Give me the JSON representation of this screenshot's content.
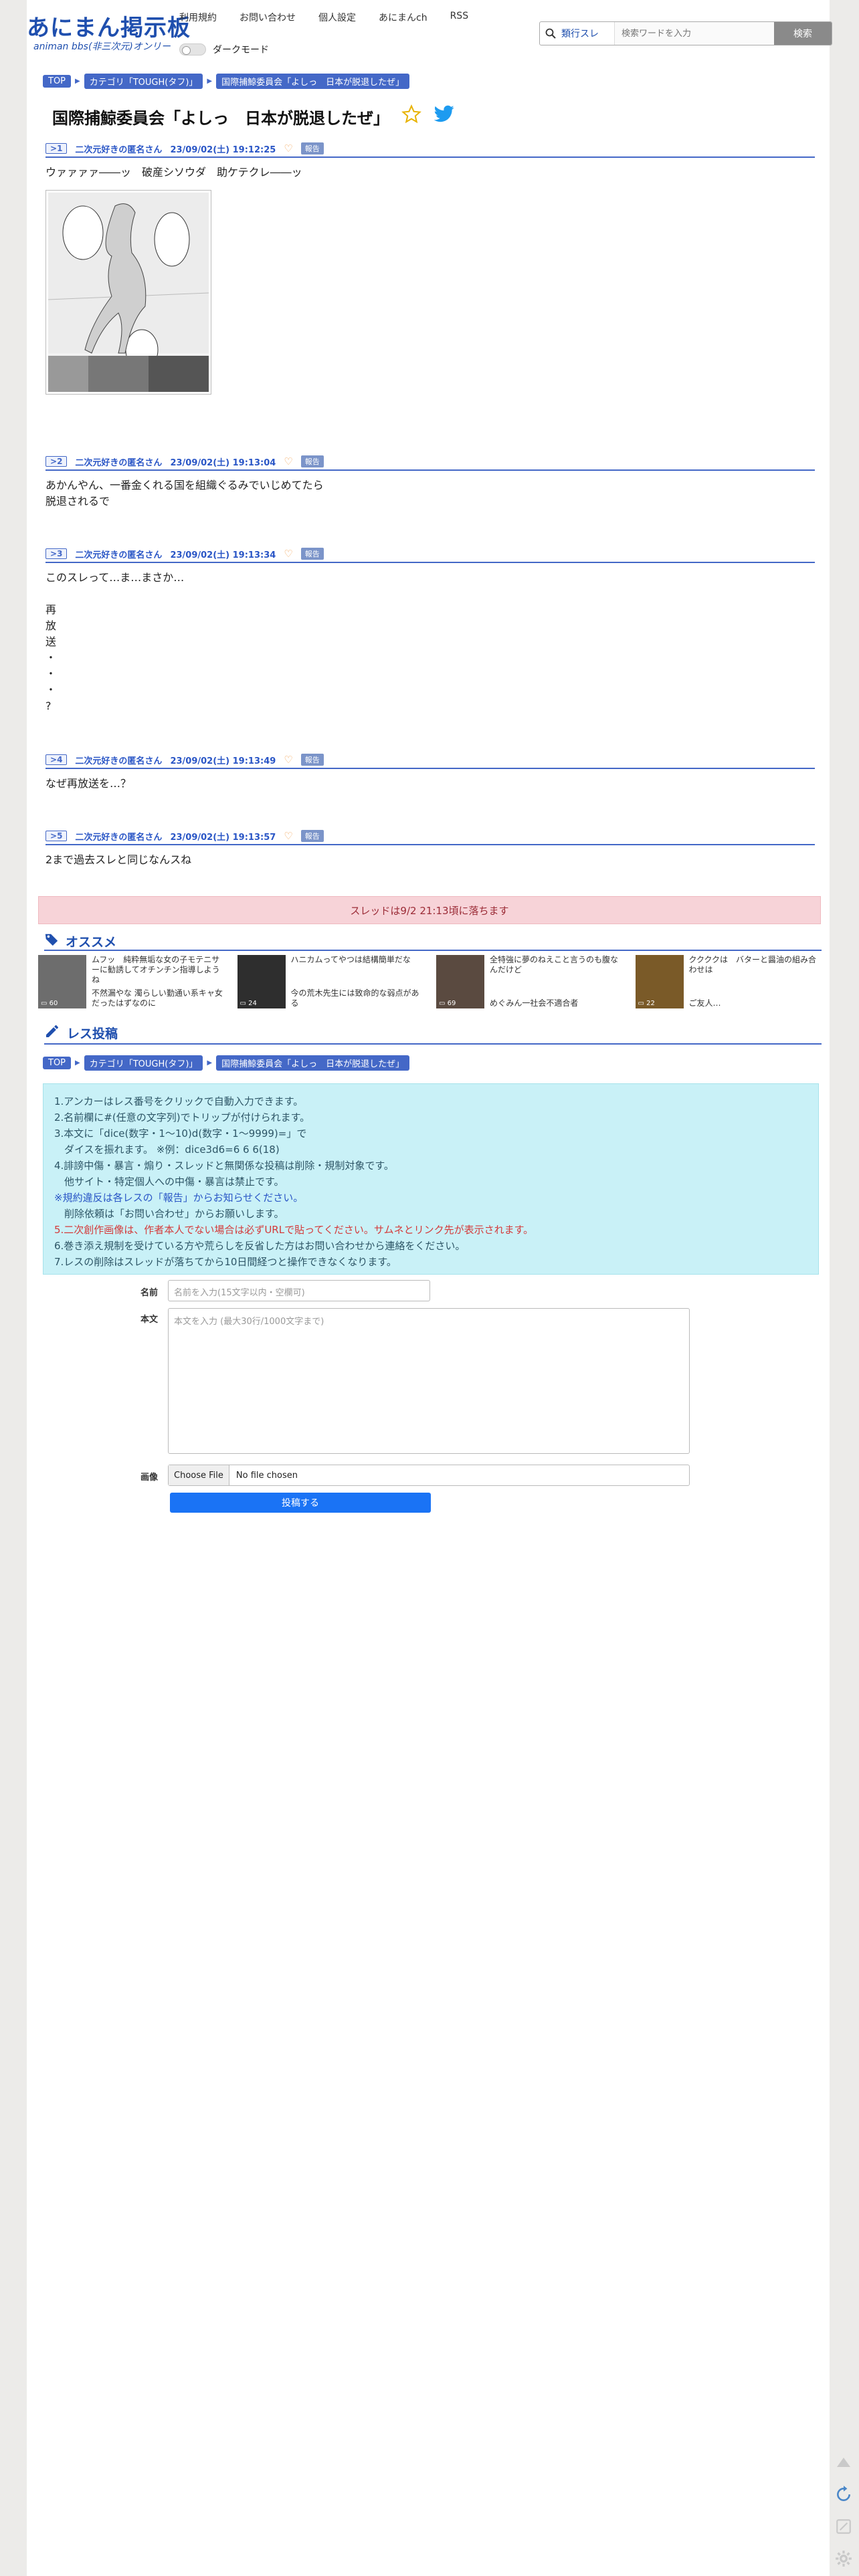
{
  "header": {
    "logo_title": "あにまん掲示板",
    "logo_sub": "animan bbs(非三次元)オンリー",
    "nav": [
      "利用規約",
      "お問い合わせ",
      "個人設定",
      "あにまんch",
      "RSS"
    ],
    "dark_mode_label": "ダークモード",
    "search_select": "類行スレ",
    "search_placeholder": "検索ワードを入力",
    "search_button": "検索"
  },
  "breadcrumb": [
    "TOP",
    "カテゴリ「TOUGH(タフ)」",
    "国際捕鯨委員会「よしっ　日本が脱退したぜ」"
  ],
  "thread_title": "国際捕鯨委員会「よしっ　日本が脱退したぜ」",
  "posts": [
    {
      "no": "1",
      "name": "二次元好きの匿名さん",
      "date": "23/09/02(土) 19:12:25",
      "report": "報告",
      "body": "ウァァァァ――ッ　破産シソウダ　助ケテクレ――ッ"
    },
    {
      "no": "2",
      "name": "二次元好きの匿名さん",
      "date": "23/09/02(土) 19:13:04",
      "report": "報告",
      "body": "あかんやん、一番金くれる国を組織ぐるみでいじめてたら\n脱退されるで"
    },
    {
      "no": "3",
      "name": "二次元好きの匿名さん",
      "date": "23/09/02(土) 19:13:34",
      "report": "報告",
      "body": "このスレって…ま…まさか…\n\n再\n放\n送\n・\n・\n・\n?"
    },
    {
      "no": "4",
      "name": "二次元好きの匿名さん",
      "date": "23/09/02(土) 19:13:49",
      "report": "報告",
      "body": "なぜ再放送を…？"
    },
    {
      "no": "5",
      "name": "二次元好きの匿名さん",
      "date": "23/09/02(土) 19:13:57",
      "report": "報告",
      "body": "2まで過去スレと同じなんスね"
    }
  ],
  "fall_banner": "スレッドは9/2 21:13頃に落ちます",
  "recommend": {
    "title": "オススメ",
    "items": [
      {
        "title": "ムフッ　純粋無垢な女の子モテニサーに勧誘してオチンチン指導しようね",
        "sub": "不然漏やな 濁らしい勤通い系キャ女だったはずなのに",
        "count": "60"
      },
      {
        "title": "ハニカムってやつは結構簡単だな",
        "sub": "今の荒木先生には致命的な弱点がある",
        "count": "24"
      },
      {
        "title": "全特強に夢のねえこと言うのも腹なんだけど",
        "sub": "めぐみん一社会不適合者",
        "count": "69"
      },
      {
        "title": "ククククは　バターと醤油の組み合わせは",
        "sub": "ご友人…",
        "count": "22"
      }
    ]
  },
  "reply_section": {
    "title": "レス投稿",
    "rules": [
      {
        "text": "1.アンカーはレス番号をクリックで自動入力できます。",
        "tone": "normal"
      },
      {
        "text": "2.名前欄に#(任意の文字列)でトリップが付けられます。",
        "tone": "normal"
      },
      {
        "text": "3.本文に「dice(数字・1〜10)d(数字・1〜9999)=」で",
        "tone": "normal"
      },
      {
        "text": "　ダイスを振れます。 ※例：dice3d6=6 6 6(18)",
        "tone": "normal"
      },
      {
        "text": "4.誹謗中傷・暴言・煽り・スレッドと無関係な投稿は削除・規制対象です。",
        "tone": "normal"
      },
      {
        "text": "　他サイト・特定個人への中傷・暴言は禁止です。",
        "tone": "normal"
      },
      {
        "text": "※規約違反は各レスの「報告」からお知らせください。",
        "tone": "normal"
      },
      {
        "text": "　削除依頼は「お問い合わせ」からお願いします。",
        "tone": "normal"
      },
      {
        "text": "5.二次創作画像は、作者本人でない場合は必ずURLで貼ってください。サムネとリンク先が表示されます。",
        "tone": "red"
      },
      {
        "text": "6.巻き添え規制を受けている方や荒らしを反省した方はお問い合わせから連絡をください。",
        "tone": "normal"
      },
      {
        "text": "7.レスの削除はスレッドが落ちてから10日間経つと操作できなくなります。",
        "tone": "normal"
      }
    ],
    "name_label": "名前",
    "name_placeholder": "名前を入力(15文字以内・空欄可)",
    "body_label": "本文",
    "body_placeholder": "本文を入力 (最大30行/1000文字まで)",
    "image_label": "画像",
    "file_button": "Choose File",
    "file_status": "No file chosen",
    "submit": "投稿する"
  },
  "colors": {
    "accent": "#4468c7",
    "logo": "#1f4fae",
    "banner": "#f7d3d8",
    "rules_bg": "#c9f1f7",
    "submit": "#1a73f5"
  }
}
